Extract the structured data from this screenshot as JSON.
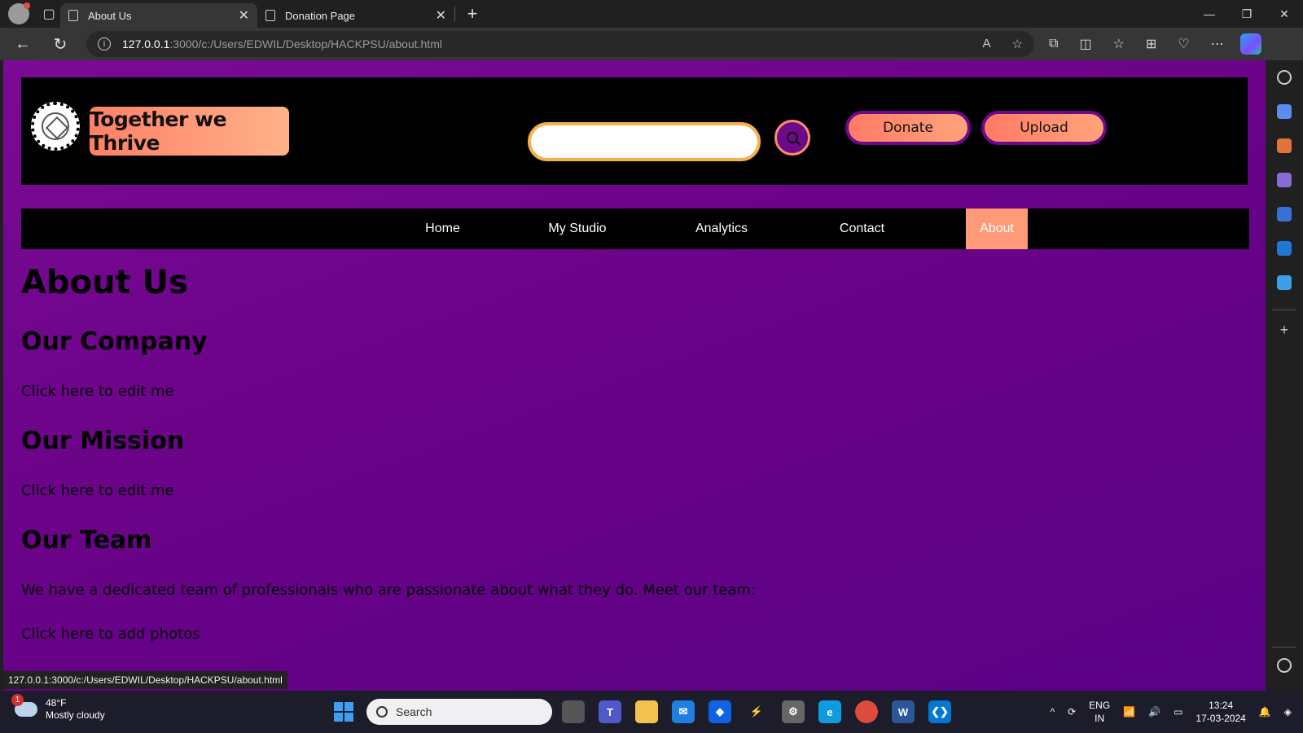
{
  "browser": {
    "tabs": [
      {
        "title": "About Us",
        "active": true
      },
      {
        "title": "Donation Page",
        "active": false
      }
    ],
    "url_host": "127.0.0.1",
    "url_path": ":3000/c:/Users/EDWIL/Desktop/HACKPSU/about.html",
    "status_url": "127.0.0.1:3000/c:/Users/EDWIL/Desktop/HACKPSU/about.html"
  },
  "header": {
    "brand": "Together we Thrive",
    "search_placeholder": "",
    "donate_label": "Donate",
    "upload_label": "Upload"
  },
  "nav": {
    "items": [
      {
        "label": "Home"
      },
      {
        "label": "My Studio"
      },
      {
        "label": "Analytics"
      },
      {
        "label": "Contact"
      },
      {
        "label": "About"
      }
    ],
    "active_index": 4
  },
  "content": {
    "title": "About Us",
    "company_heading": "Our Company",
    "company_text": "Click here to edit me",
    "mission_heading": "Our Mission",
    "mission_text": "Click here to edit me",
    "team_heading": "Our Team",
    "team_text": "We have a dedicated team of professionals who are passionate about what they do. Meet our team:",
    "team_photos": "Click here to add photos"
  },
  "taskbar": {
    "weather_temp": "48°F",
    "weather_desc": "Mostly cloudy",
    "weather_badge": "1",
    "search_label": "Search",
    "lang_line1": "ENG",
    "lang_line2": "IN",
    "time": "13:24",
    "date": "17-03-2024"
  },
  "colors": {
    "page_gradient_start": "#7b0a96",
    "page_gradient_end": "#5a0185",
    "accent_orange": "#ff9a78",
    "search_border": "#f5b04a"
  }
}
